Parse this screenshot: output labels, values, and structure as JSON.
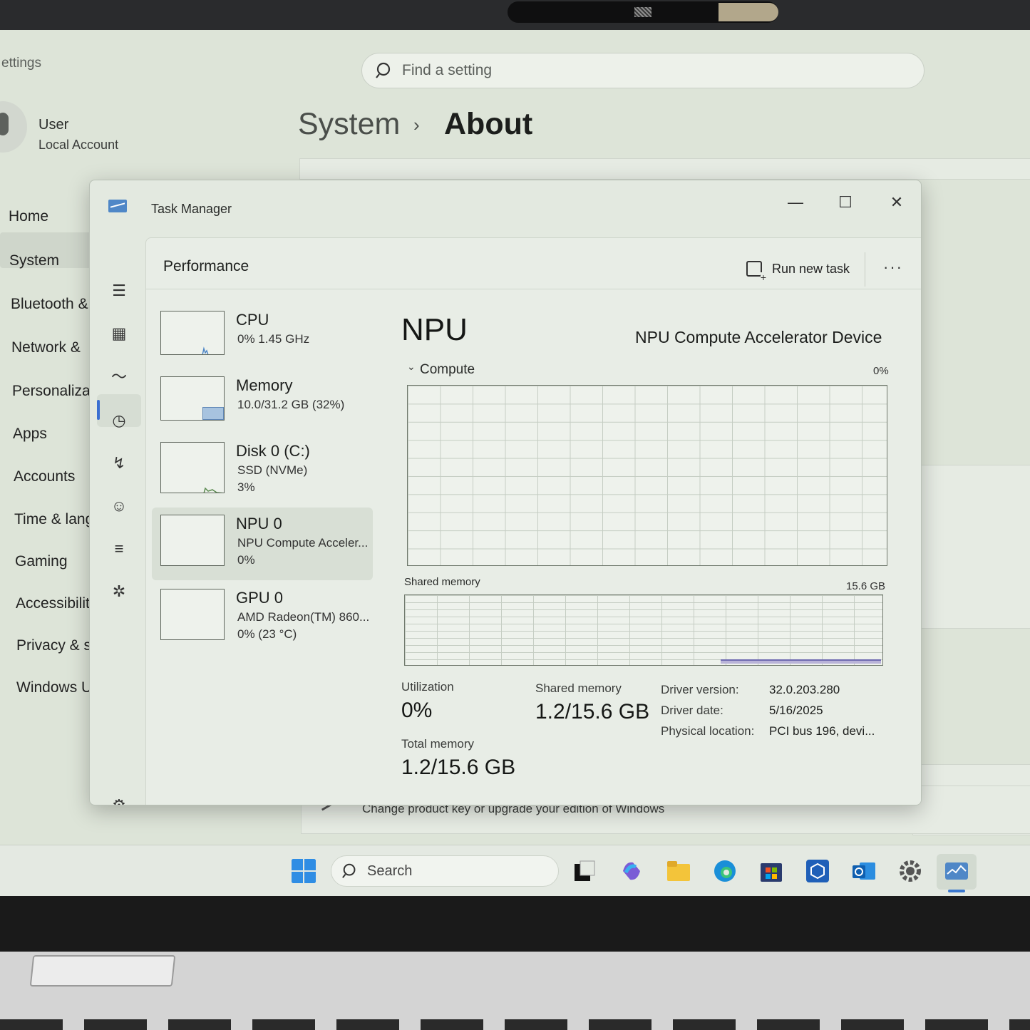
{
  "settings": {
    "title": "ettings",
    "search_placeholder": "Find a setting",
    "user": {
      "name": "User",
      "account": "Local Account"
    },
    "breadcrumb": {
      "parent": "System",
      "separator": "›",
      "current": "About"
    },
    "nav": [
      "Home",
      "System",
      "Bluetooth &",
      "Network &",
      "Personalizat",
      "Apps",
      "Accounts",
      "Time & lang",
      "Gaming",
      "Accessibility",
      "Privacy & se",
      "Windows Up"
    ],
    "selected_nav": "System",
    "change_key_text": "Change product key or upgrade your edition of Windows"
  },
  "taskbar": {
    "search_label": "Search",
    "icons": [
      "start-icon",
      "task-view-icon",
      "copilot-icon",
      "file-explorer-icon",
      "edge-icon",
      "store-icon",
      "3d-app-icon",
      "outlook-icon",
      "settings-icon",
      "task-manager-icon"
    ]
  },
  "task_manager": {
    "window_title": "Task Manager",
    "page_title": "Performance",
    "run_new_task": "Run new task",
    "more": "···",
    "resources": [
      {
        "name": "CPU",
        "line1": "0%  1.45 GHz",
        "line2": ""
      },
      {
        "name": "Memory",
        "line1": "10.0/31.2 GB (32%)",
        "line2": ""
      },
      {
        "name": "Disk 0 (C:)",
        "line1": "SSD (NVMe)",
        "line2": "3%"
      },
      {
        "name": "NPU 0",
        "line1": "NPU Compute Acceler...",
        "line2": "0%"
      },
      {
        "name": "GPU 0",
        "line1": "AMD Radeon(TM) 860...",
        "line2": "0%  (23 °C)"
      }
    ],
    "selected_resource": "NPU 0",
    "detail": {
      "title": "NPU",
      "device": "NPU Compute Accelerator Device",
      "compute_label": "Compute",
      "compute_pct": "0%",
      "shared_memory_label": "Shared memory",
      "shared_memory_max": "15.6 GB",
      "utilization_label": "Utilization",
      "utilization_value": "0%",
      "shared_memory_stat_label": "Shared memory",
      "shared_memory_stat_value": "1.2/15.6 GB",
      "total_memory_label": "Total memory",
      "total_memory_value": "1.2/15.6 GB",
      "info": [
        {
          "key": "Driver version:",
          "value": "32.0.203.280"
        },
        {
          "key": "Driver date:",
          "value": "5/16/2025"
        },
        {
          "key": "Physical location:",
          "value": "PCI bus 196, devi..."
        }
      ]
    }
  }
}
